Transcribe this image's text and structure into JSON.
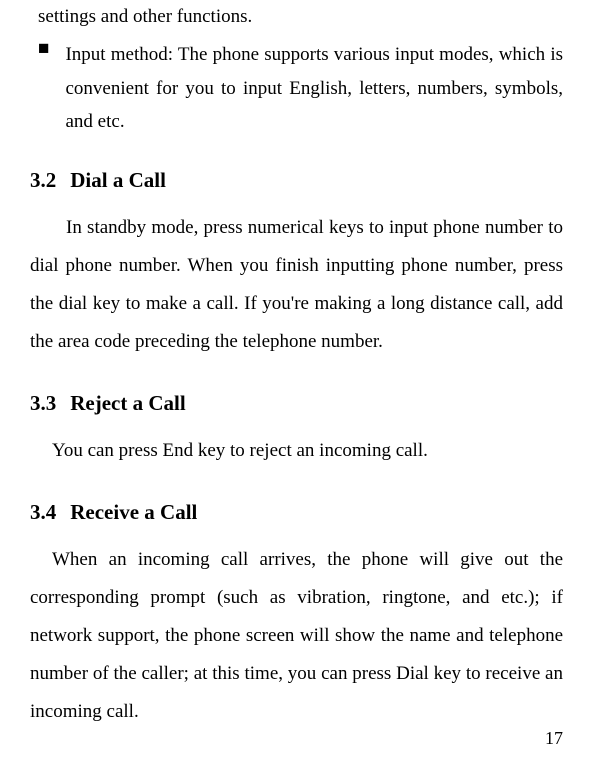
{
  "fragment_top": "settings and other functions.",
  "bullet": {
    "marker": "■",
    "text": "Input method: The phone supports various input modes, which is convenient for you to input English, letters, numbers, symbols, and etc."
  },
  "sections": [
    {
      "number": "3.2",
      "title": "Dial a Call",
      "body": "In standby mode, press numerical keys to input phone number to dial phone number. When you finish inputting phone number, press the dial key to make a call. If you're making a long distance call, add the area code preceding the telephone number.",
      "indent": "large"
    },
    {
      "number": "3.3",
      "title": "Reject a Call",
      "body": "You can press End key to reject an incoming call.",
      "indent": "small"
    },
    {
      "number": "3.4",
      "title": "Receive a Call",
      "body": "When an incoming call arrives, the phone will give out the corresponding prompt (such as vibration, ringtone, and etc.); if network support, the phone screen will show the name and telephone number of the caller; at this time, you can press Dial key to receive an incoming call.",
      "indent": "small"
    }
  ],
  "page_number": "17"
}
